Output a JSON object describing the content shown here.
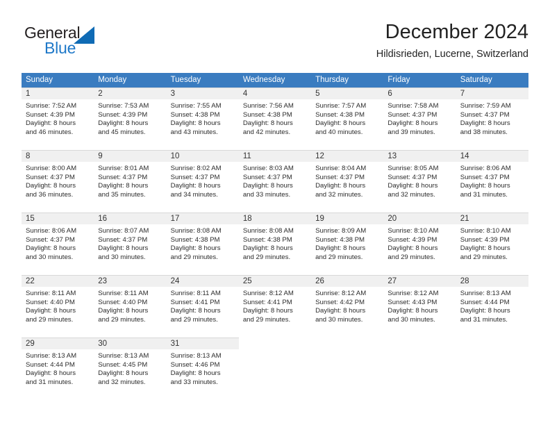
{
  "brand": {
    "name_part1": "General",
    "name_part2": "Blue",
    "triangle_color": "#0f6bb5",
    "blue_text_color": "#1e78c8"
  },
  "header": {
    "title": "December 2024",
    "subtitle": "Hildisrieden, Lucerne, Switzerland"
  },
  "theme": {
    "header_row_bg": "#3a7cc0",
    "header_row_text": "#ffffff",
    "daynum_bar_bg": "#f0f0f0",
    "page_bg": "#ffffff"
  },
  "weekdays": [
    "Sunday",
    "Monday",
    "Tuesday",
    "Wednesday",
    "Thursday",
    "Friday",
    "Saturday"
  ],
  "weeks": [
    [
      {
        "day": "1",
        "sunrise": "Sunrise: 7:52 AM",
        "sunset": "Sunset: 4:39 PM",
        "daylight_line1": "Daylight: 8 hours",
        "daylight_line2": "and 46 minutes."
      },
      {
        "day": "2",
        "sunrise": "Sunrise: 7:53 AM",
        "sunset": "Sunset: 4:39 PM",
        "daylight_line1": "Daylight: 8 hours",
        "daylight_line2": "and 45 minutes."
      },
      {
        "day": "3",
        "sunrise": "Sunrise: 7:55 AM",
        "sunset": "Sunset: 4:38 PM",
        "daylight_line1": "Daylight: 8 hours",
        "daylight_line2": "and 43 minutes."
      },
      {
        "day": "4",
        "sunrise": "Sunrise: 7:56 AM",
        "sunset": "Sunset: 4:38 PM",
        "daylight_line1": "Daylight: 8 hours",
        "daylight_line2": "and 42 minutes."
      },
      {
        "day": "5",
        "sunrise": "Sunrise: 7:57 AM",
        "sunset": "Sunset: 4:38 PM",
        "daylight_line1": "Daylight: 8 hours",
        "daylight_line2": "and 40 minutes."
      },
      {
        "day": "6",
        "sunrise": "Sunrise: 7:58 AM",
        "sunset": "Sunset: 4:37 PM",
        "daylight_line1": "Daylight: 8 hours",
        "daylight_line2": "and 39 minutes."
      },
      {
        "day": "7",
        "sunrise": "Sunrise: 7:59 AM",
        "sunset": "Sunset: 4:37 PM",
        "daylight_line1": "Daylight: 8 hours",
        "daylight_line2": "and 38 minutes."
      }
    ],
    [
      {
        "day": "8",
        "sunrise": "Sunrise: 8:00 AM",
        "sunset": "Sunset: 4:37 PM",
        "daylight_line1": "Daylight: 8 hours",
        "daylight_line2": "and 36 minutes."
      },
      {
        "day": "9",
        "sunrise": "Sunrise: 8:01 AM",
        "sunset": "Sunset: 4:37 PM",
        "daylight_line1": "Daylight: 8 hours",
        "daylight_line2": "and 35 minutes."
      },
      {
        "day": "10",
        "sunrise": "Sunrise: 8:02 AM",
        "sunset": "Sunset: 4:37 PM",
        "daylight_line1": "Daylight: 8 hours",
        "daylight_line2": "and 34 minutes."
      },
      {
        "day": "11",
        "sunrise": "Sunrise: 8:03 AM",
        "sunset": "Sunset: 4:37 PM",
        "daylight_line1": "Daylight: 8 hours",
        "daylight_line2": "and 33 minutes."
      },
      {
        "day": "12",
        "sunrise": "Sunrise: 8:04 AM",
        "sunset": "Sunset: 4:37 PM",
        "daylight_line1": "Daylight: 8 hours",
        "daylight_line2": "and 32 minutes."
      },
      {
        "day": "13",
        "sunrise": "Sunrise: 8:05 AM",
        "sunset": "Sunset: 4:37 PM",
        "daylight_line1": "Daylight: 8 hours",
        "daylight_line2": "and 32 minutes."
      },
      {
        "day": "14",
        "sunrise": "Sunrise: 8:06 AM",
        "sunset": "Sunset: 4:37 PM",
        "daylight_line1": "Daylight: 8 hours",
        "daylight_line2": "and 31 minutes."
      }
    ],
    [
      {
        "day": "15",
        "sunrise": "Sunrise: 8:06 AM",
        "sunset": "Sunset: 4:37 PM",
        "daylight_line1": "Daylight: 8 hours",
        "daylight_line2": "and 30 minutes."
      },
      {
        "day": "16",
        "sunrise": "Sunrise: 8:07 AM",
        "sunset": "Sunset: 4:37 PM",
        "daylight_line1": "Daylight: 8 hours",
        "daylight_line2": "and 30 minutes."
      },
      {
        "day": "17",
        "sunrise": "Sunrise: 8:08 AM",
        "sunset": "Sunset: 4:38 PM",
        "daylight_line1": "Daylight: 8 hours",
        "daylight_line2": "and 29 minutes."
      },
      {
        "day": "18",
        "sunrise": "Sunrise: 8:08 AM",
        "sunset": "Sunset: 4:38 PM",
        "daylight_line1": "Daylight: 8 hours",
        "daylight_line2": "and 29 minutes."
      },
      {
        "day": "19",
        "sunrise": "Sunrise: 8:09 AM",
        "sunset": "Sunset: 4:38 PM",
        "daylight_line1": "Daylight: 8 hours",
        "daylight_line2": "and 29 minutes."
      },
      {
        "day": "20",
        "sunrise": "Sunrise: 8:10 AM",
        "sunset": "Sunset: 4:39 PM",
        "daylight_line1": "Daylight: 8 hours",
        "daylight_line2": "and 29 minutes."
      },
      {
        "day": "21",
        "sunrise": "Sunrise: 8:10 AM",
        "sunset": "Sunset: 4:39 PM",
        "daylight_line1": "Daylight: 8 hours",
        "daylight_line2": "and 29 minutes."
      }
    ],
    [
      {
        "day": "22",
        "sunrise": "Sunrise: 8:11 AM",
        "sunset": "Sunset: 4:40 PM",
        "daylight_line1": "Daylight: 8 hours",
        "daylight_line2": "and 29 minutes."
      },
      {
        "day": "23",
        "sunrise": "Sunrise: 8:11 AM",
        "sunset": "Sunset: 4:40 PM",
        "daylight_line1": "Daylight: 8 hours",
        "daylight_line2": "and 29 minutes."
      },
      {
        "day": "24",
        "sunrise": "Sunrise: 8:11 AM",
        "sunset": "Sunset: 4:41 PM",
        "daylight_line1": "Daylight: 8 hours",
        "daylight_line2": "and 29 minutes."
      },
      {
        "day": "25",
        "sunrise": "Sunrise: 8:12 AM",
        "sunset": "Sunset: 4:41 PM",
        "daylight_line1": "Daylight: 8 hours",
        "daylight_line2": "and 29 minutes."
      },
      {
        "day": "26",
        "sunrise": "Sunrise: 8:12 AM",
        "sunset": "Sunset: 4:42 PM",
        "daylight_line1": "Daylight: 8 hours",
        "daylight_line2": "and 30 minutes."
      },
      {
        "day": "27",
        "sunrise": "Sunrise: 8:12 AM",
        "sunset": "Sunset: 4:43 PM",
        "daylight_line1": "Daylight: 8 hours",
        "daylight_line2": "and 30 minutes."
      },
      {
        "day": "28",
        "sunrise": "Sunrise: 8:13 AM",
        "sunset": "Sunset: 4:44 PM",
        "daylight_line1": "Daylight: 8 hours",
        "daylight_line2": "and 31 minutes."
      }
    ],
    [
      {
        "day": "29",
        "sunrise": "Sunrise: 8:13 AM",
        "sunset": "Sunset: 4:44 PM",
        "daylight_line1": "Daylight: 8 hours",
        "daylight_line2": "and 31 minutes."
      },
      {
        "day": "30",
        "sunrise": "Sunrise: 8:13 AM",
        "sunset": "Sunset: 4:45 PM",
        "daylight_line1": "Daylight: 8 hours",
        "daylight_line2": "and 32 minutes."
      },
      {
        "day": "31",
        "sunrise": "Sunrise: 8:13 AM",
        "sunset": "Sunset: 4:46 PM",
        "daylight_line1": "Daylight: 8 hours",
        "daylight_line2": "and 33 minutes."
      },
      {
        "day": "",
        "sunrise": "",
        "sunset": "",
        "daylight_line1": "",
        "daylight_line2": ""
      },
      {
        "day": "",
        "sunrise": "",
        "sunset": "",
        "daylight_line1": "",
        "daylight_line2": ""
      },
      {
        "day": "",
        "sunrise": "",
        "sunset": "",
        "daylight_line1": "",
        "daylight_line2": ""
      },
      {
        "day": "",
        "sunrise": "",
        "sunset": "",
        "daylight_line1": "",
        "daylight_line2": ""
      }
    ]
  ]
}
